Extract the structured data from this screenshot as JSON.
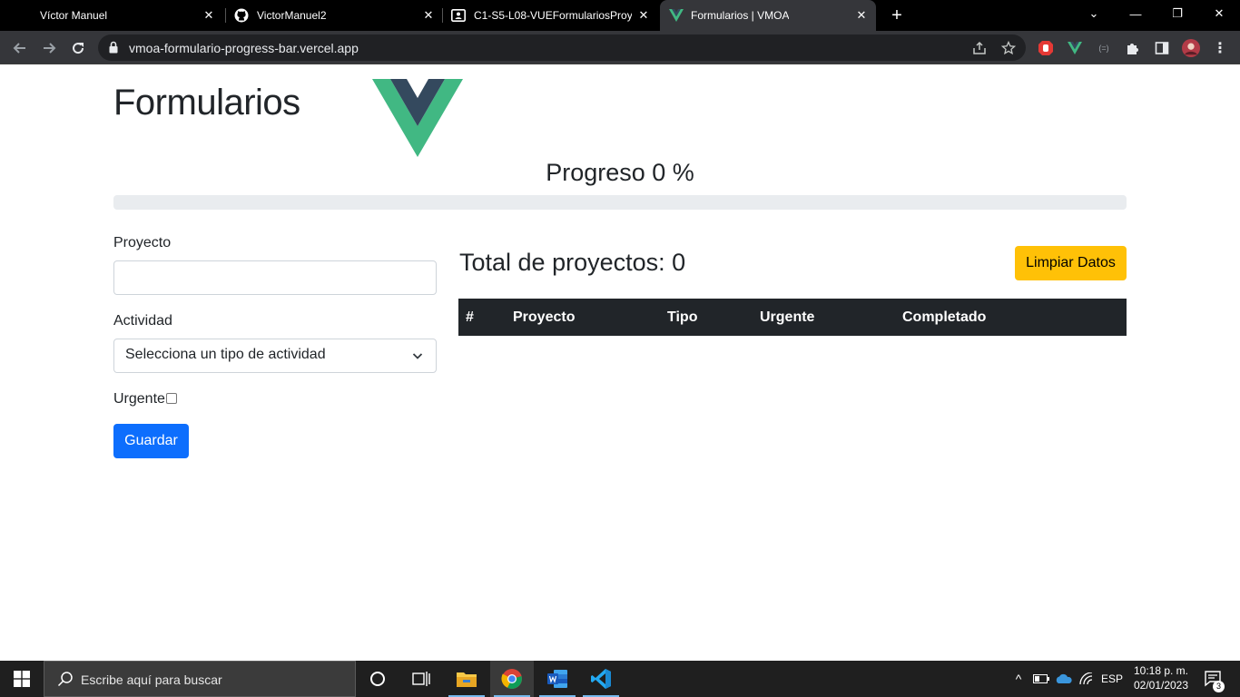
{
  "browser": {
    "tabs": [
      {
        "title": "Víctor Manuel",
        "icon": "person-icon",
        "active": false
      },
      {
        "title": "VictorManuel2",
        "icon": "github-icon",
        "active": false
      },
      {
        "title": "C1-S5-L08-VUEFormulariosProye",
        "icon": "contact-card-icon",
        "active": false
      },
      {
        "title": "Formularios | VMOA",
        "icon": "vue-icon",
        "active": true
      }
    ],
    "tab_close": "✕",
    "new_tab": "+",
    "window_controls": {
      "dropdown": "⌄",
      "minimize": "—",
      "restore": "❐",
      "close": "✕"
    },
    "url": "vmoa-formulario-progress-bar.vercel.app",
    "extensions": [
      "adblock-icon",
      "vue-devtools-icon",
      "dev-icon",
      "puzzle-icon",
      "sidepanel-icon",
      "profile-avatar"
    ]
  },
  "page": {
    "title": "Formularios",
    "progress_label": "Progreso 0 %",
    "progress_value": 0,
    "form": {
      "proyecto_label": "Proyecto",
      "proyecto_value": "",
      "actividad_label": "Actividad",
      "actividad_selected": "Selecciona un tipo de actividad",
      "urgente_label": "Urgente",
      "urgente_checked": false,
      "save_label": "Guardar"
    },
    "total_label": "Total de proyectos: 0",
    "clear_label": "Limpiar Datos",
    "table": {
      "headers": [
        "#",
        "Proyecto",
        "Tipo",
        "Urgente",
        "Completado"
      ],
      "rows": []
    },
    "colors": {
      "primary": "#0d6efd",
      "warning": "#ffc107",
      "dark": "#212529",
      "vue_green": "#41b883",
      "vue_navy": "#34495e"
    }
  },
  "taskbar": {
    "search_placeholder": "Escribe aquí para buscar",
    "apps": [
      "cortana-icon",
      "task-view-icon",
      "file-explorer-icon",
      "chrome-icon",
      "word-icon",
      "vscode-icon"
    ],
    "language": "ESP",
    "time": "10:18 p. m.",
    "date": "02/01/2023",
    "notification_count": "3"
  }
}
